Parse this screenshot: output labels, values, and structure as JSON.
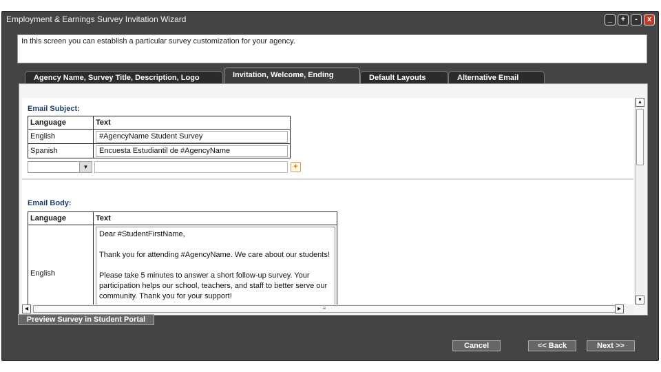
{
  "window": {
    "title": "Employment & Earnings Survey Invitation Wizard",
    "controls": [
      "_",
      "+",
      "-",
      "x"
    ]
  },
  "intro_text": "In this screen you can establish a particular survey customization for your agency.",
  "tabs": [
    {
      "label": "Agency Name, Survey Title, Description, Logo"
    },
    {
      "label": "Invitation, Welcome, Ending"
    },
    {
      "label": "Default Layouts"
    },
    {
      "label": "Alternative Email"
    }
  ],
  "email_subject": {
    "title": "Email Subject:",
    "headers": [
      "Language",
      "Text"
    ],
    "rows": [
      {
        "language": "English",
        "text": "#AgencyName Student Survey"
      },
      {
        "language": "Spanish",
        "text": "Encuesta Estudiantil de #AgencyName"
      }
    ],
    "add_icon": "add-icon"
  },
  "email_body": {
    "title": "Email Body:",
    "headers": [
      "Language",
      "Text"
    ],
    "rows": [
      {
        "language": "English",
        "text": "Dear #StudentFirstName,\n\nThank you for attending #AgencyName. We care about our students!\n\nPlease take 5 minutes to answer a short follow-up survey. Your\nparticipation helps our school, teachers, and staff to better serve our\ncommunity. Thank you for your support!"
      }
    ]
  },
  "scroll": {
    "up": "▲",
    "down": "▼",
    "left": "◀",
    "right": "▶",
    "grip": "≡"
  },
  "buttons": {
    "preview": "Preview Survey in Student Portal",
    "cancel": "Cancel",
    "back": "<< Back",
    "next": "Next >>"
  },
  "colors": {
    "window_bg": "#444444",
    "section_title": "#1f3f6a",
    "close_button": "#c0392b"
  }
}
